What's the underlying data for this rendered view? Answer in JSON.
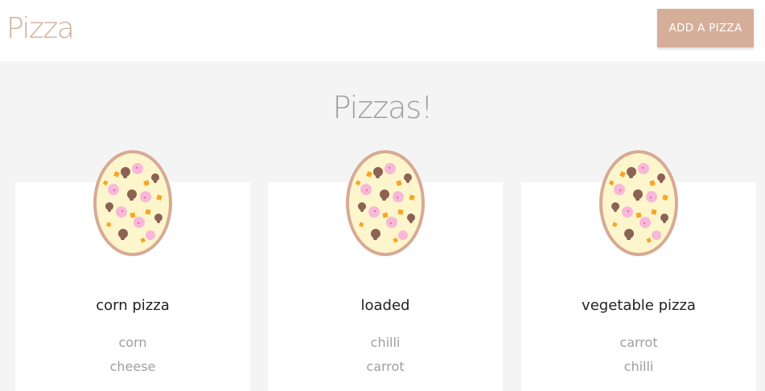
{
  "navbar": {
    "brand": "Pizza",
    "add_button_label": "ADD A PIZZA"
  },
  "main": {
    "title": "Pizzas!"
  },
  "pizzas": [
    {
      "name": "corn pizza",
      "ingredients": [
        "corn",
        "cheese"
      ]
    },
    {
      "name": "loaded",
      "ingredients": [
        "chilli",
        "carrot"
      ]
    },
    {
      "name": "vegetable pizza",
      "ingredients": [
        "carrot",
        "chilli"
      ]
    }
  ],
  "colors": {
    "brand": "#d3ae9b",
    "button_bg": "#d5ae99",
    "page_bg": "#f4f4f4",
    "card_bg": "#ffffff",
    "muted_text": "#9e9e9e"
  },
  "icons": {
    "pizza": "pizza-icon"
  }
}
